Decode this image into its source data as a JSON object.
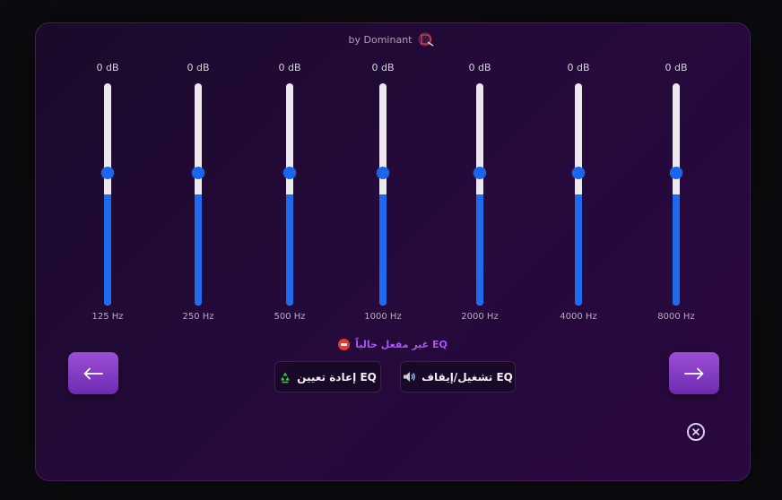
{
  "header": {
    "brand_label": "by Dominant",
    "logo_icon": "dominant-logo-icon"
  },
  "equalizer": {
    "bands": [
      {
        "frequency": "125 Hz",
        "gain": "0 dB",
        "level": 0.5
      },
      {
        "frequency": "250 Hz",
        "gain": "0 dB",
        "level": 0.5
      },
      {
        "frequency": "500 Hz",
        "gain": "0 dB",
        "level": 0.5
      },
      {
        "frequency": "1000 Hz",
        "gain": "0 dB",
        "level": 0.5
      },
      {
        "frequency": "2000 Hz",
        "gain": "0 dB",
        "level": 0.5
      },
      {
        "frequency": "4000 Hz",
        "gain": "0 dB",
        "level": 0.5
      },
      {
        "frequency": "8000 Hz",
        "gain": "0 dB",
        "level": 0.5
      }
    ]
  },
  "status": {
    "text": "EQ غير مفعل حالياً",
    "icon": "no-entry-icon",
    "color": "#a855f7"
  },
  "controls": {
    "reset_label": "EQ إعادة تعيين",
    "reset_icon": "recycle-icon",
    "toggle_label": "EQ تشغيل/إيقاف",
    "toggle_icon": "speaker-icon",
    "prev_icon": "arrow-left-icon",
    "next_icon": "arrow-right-icon",
    "close_icon": "close-icon"
  },
  "colors": {
    "accent": "#a855f7",
    "slider_fill": "#1e6bf0",
    "button_gradient_top": "#9b4fd6",
    "button_gradient_bottom": "#6d2ab0"
  }
}
